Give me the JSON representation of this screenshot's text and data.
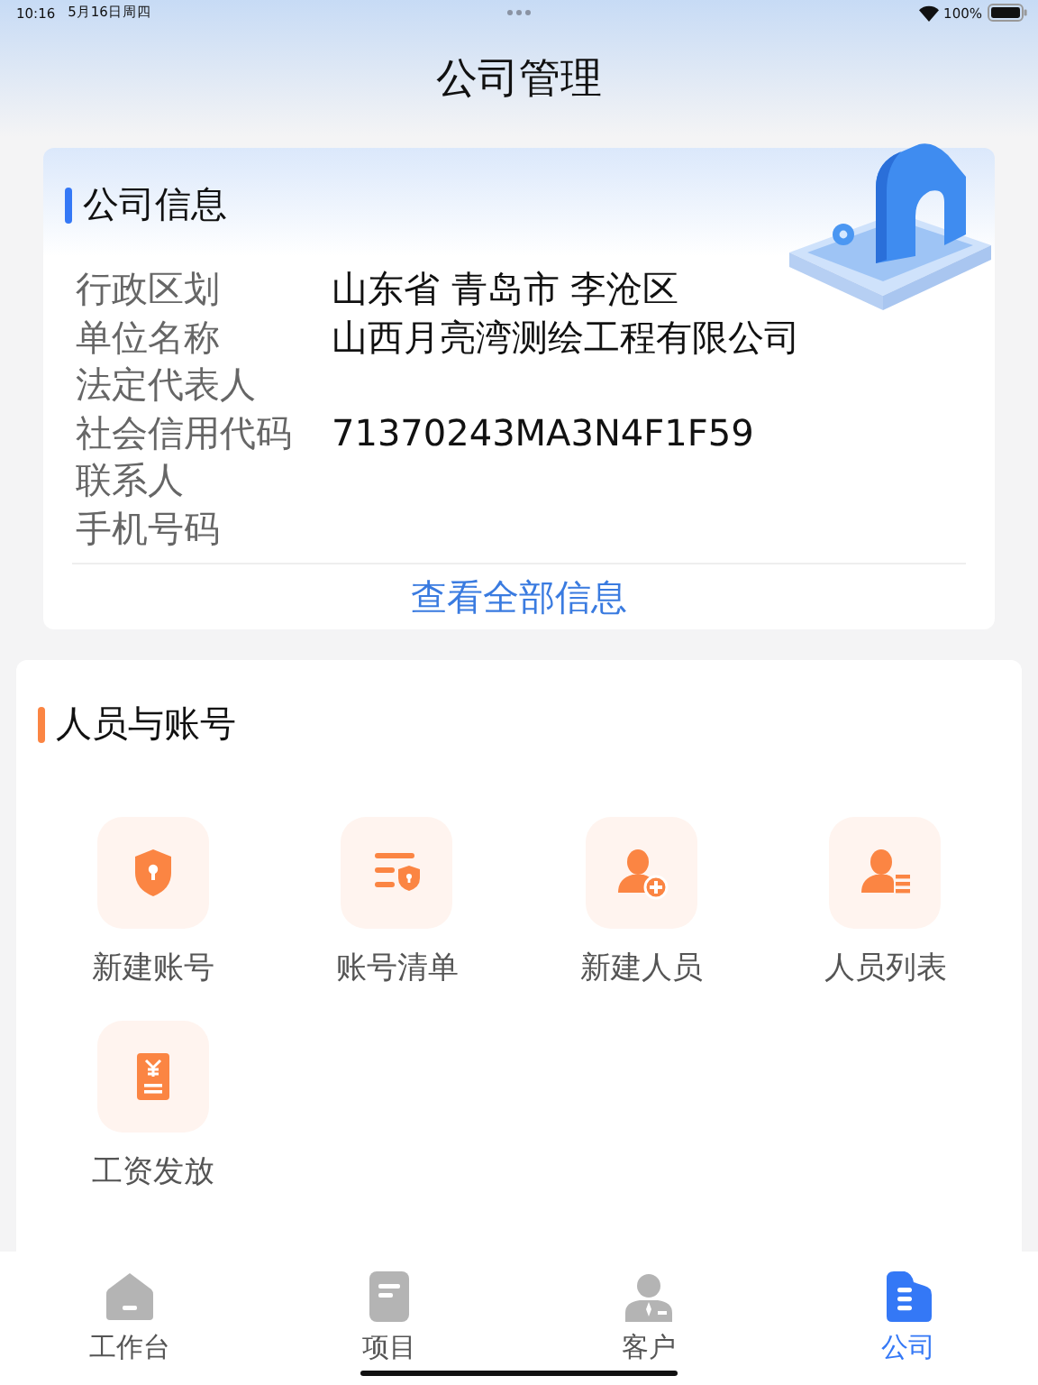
{
  "status_bar": {
    "time": "10:16",
    "date": "5月16日周四",
    "battery": "100%"
  },
  "header": {
    "title": "公司管理"
  },
  "company_info": {
    "title": "公司信息",
    "rows": [
      {
        "label": "行政区划",
        "value": "山东省 青岛市 李沧区"
      },
      {
        "label": "单位名称",
        "value": "山西月亮湾测绘工程有限公司"
      },
      {
        "label": "法定代表人"
      },
      {
        "label": "社会信用代码",
        "value": "71370243MA3N4F1F59"
      },
      {
        "label": "联系人"
      },
      {
        "label": "手机号码"
      }
    ],
    "link": "查看全部信息"
  },
  "staff_accounts": {
    "title": "人员与账号",
    "items": [
      {
        "label": "新建账号"
      },
      {
        "label": "账号清单"
      },
      {
        "label": "新建人员"
      },
      {
        "label": "人员列表"
      },
      {
        "label": "工资发放"
      }
    ]
  },
  "tab_bar": [
    {
      "label": "工作台",
      "selected": false
    },
    {
      "label": "项目",
      "selected": false
    },
    {
      "label": "客户",
      "selected": false
    },
    {
      "label": "公司",
      "selected": true
    }
  ]
}
